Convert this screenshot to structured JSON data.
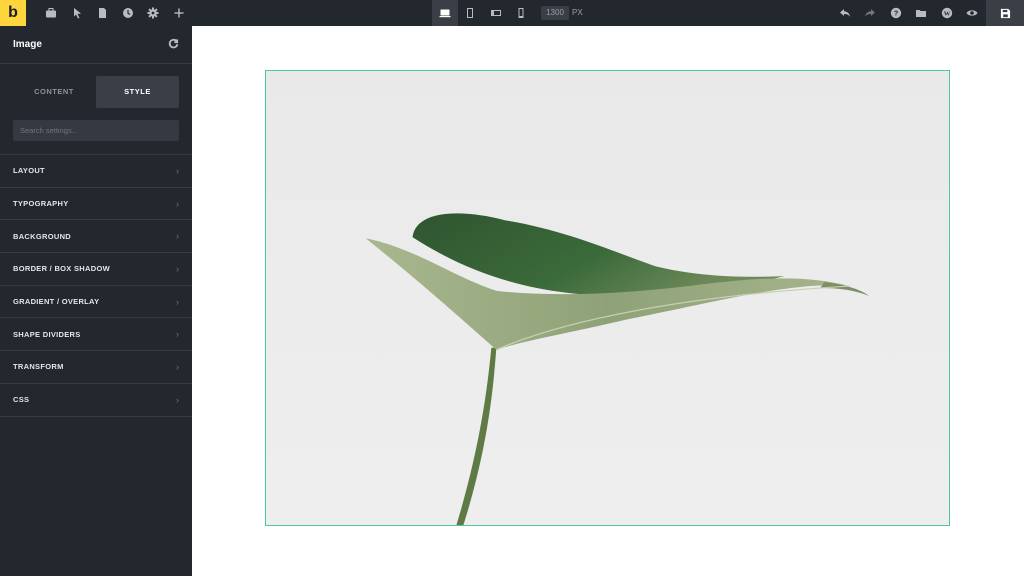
{
  "toolbar": {
    "logo": "b",
    "left_icons": [
      "briefcase-icon",
      "cursor-icon",
      "pages-icon",
      "history-icon",
      "settings-icon",
      "plus-icon"
    ],
    "breakpoints": [
      "desktop-icon",
      "tablet-portrait-icon",
      "tablet-landscape-icon",
      "mobile-icon"
    ],
    "width_value": "1300",
    "width_unit": "PX",
    "right_icons": [
      "undo-icon",
      "redo-icon",
      "help-icon",
      "folder-icon",
      "wordpress-icon",
      "preview-icon"
    ],
    "save_icon": "save-icon"
  },
  "panel": {
    "title": "Image",
    "reset_icon": "reset-icon",
    "tabs": [
      {
        "label": "CONTENT"
      },
      {
        "label": "STYLE"
      }
    ],
    "search_placeholder": "Search settings...",
    "sections": [
      {
        "label": "LAYOUT"
      },
      {
        "label": "TYPOGRAPHY"
      },
      {
        "label": "BACKGROUND"
      },
      {
        "label": "BORDER / BOX SHADOW"
      },
      {
        "label": "GRADIENT / OVERLAY"
      },
      {
        "label": "SHAPE DIVIDERS"
      },
      {
        "label": "TRANSFORM"
      },
      {
        "label": "CSS"
      }
    ]
  },
  "colors": {
    "accent": "#ffd53e",
    "selection_border": "#4fc4a8",
    "panel_bg": "#23272e"
  }
}
